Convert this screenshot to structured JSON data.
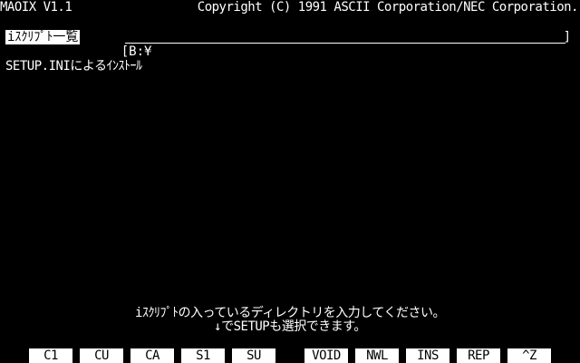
{
  "header": {
    "app_title": "MAOIX V1.1",
    "copyright": "Copyright (C) 1991 ASCII Corporation/NEC Corporation."
  },
  "script_selector": {
    "label": "iｽｸﾘﾌﾟﾄ一覧",
    "path_prefix": "[B:¥",
    "path_suffix": "]"
  },
  "script_list": [
    "SETUP.INIによるｲﾝｽﾄｰﾙ"
  ],
  "message": {
    "line1": "iｽｸﾘﾌﾟﾄの入っているディレクトリを入力してください。",
    "line2": "↓でSETUPも選択できます。"
  },
  "function_keys": [
    "C1",
    "CU",
    "CA",
    "S1",
    "SU",
    "VOID",
    "NWL",
    "INS",
    "REP",
    "^Z"
  ]
}
